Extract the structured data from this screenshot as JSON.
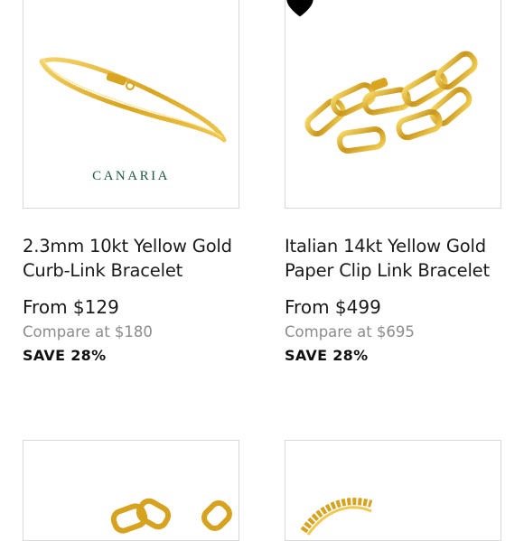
{
  "products": [
    {
      "title": "2.3mm 10kt Yellow Gold Curb-Link Bracelet",
      "brand": "CANARIA",
      "price": "From $129",
      "compare": "Compare at $180",
      "save": "SAVE 28%",
      "favorited": false
    },
    {
      "title": "Italian 14kt Yellow Gold Paper Clip Link Bracelet",
      "brand": "",
      "price": "From $499",
      "compare": "Compare at $695",
      "save": "SAVE 28%",
      "favorited": true
    },
    {
      "title": "",
      "brand": "",
      "price": "",
      "compare": "",
      "save": "",
      "favorited": false
    },
    {
      "title": "",
      "brand": "",
      "price": "",
      "compare": "",
      "save": "",
      "favorited": false
    }
  ],
  "colors": {
    "gold": "#e3b52c",
    "gold_dark": "#b8860b",
    "brand_green": "#1f5a45",
    "compare_gray": "#8c8c8c"
  },
  "icons": {
    "favorite": "heart-icon"
  }
}
